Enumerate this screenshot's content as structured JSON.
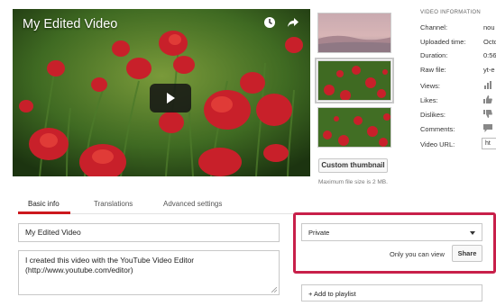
{
  "player": {
    "title": "My Edited Video",
    "icons": [
      "clock-icon",
      "share-icon",
      "play-icon"
    ]
  },
  "thumbnails": {
    "count": 3,
    "selected_index": 1,
    "custom_button": "Custom thumbnail",
    "max_size_note": "Maximum file size is 2 MB."
  },
  "info": {
    "heading": "VIDEO INFORMATION",
    "rows": [
      {
        "label": "Channel:",
        "value": "nou"
      },
      {
        "label": "Uploaded time:",
        "value": "Octo"
      },
      {
        "label": "Duration:",
        "value": "0:56"
      },
      {
        "label": "Raw file:",
        "value": "yt-e"
      },
      {
        "label": "Views:",
        "icon": "bar-chart-icon"
      },
      {
        "label": "Likes:",
        "icon": "thumbs-up-icon"
      },
      {
        "label": "Dislikes:",
        "icon": "thumbs-down-icon"
      },
      {
        "label": "Comments:",
        "icon": "comment-icon"
      },
      {
        "label": "Video URL:",
        "value": "ht"
      }
    ]
  },
  "tabs": [
    {
      "label": "Basic info",
      "active": true
    },
    {
      "label": "Translations",
      "active": false
    },
    {
      "label": "Advanced settings",
      "active": false
    }
  ],
  "form": {
    "title_value": "My Edited Video",
    "description_line1": "I created this video with the YouTube Video Editor",
    "description_line2": "(http://www.youtube.com/editor)"
  },
  "privacy": {
    "selected": "Private",
    "note": "Only you can view",
    "share_label": "Share",
    "highlight_color": "#c8204a"
  },
  "playlist": {
    "label": "+ Add to playlist"
  },
  "colors": {
    "accent_tab": "#cc181e",
    "highlight": "#c8204a"
  }
}
